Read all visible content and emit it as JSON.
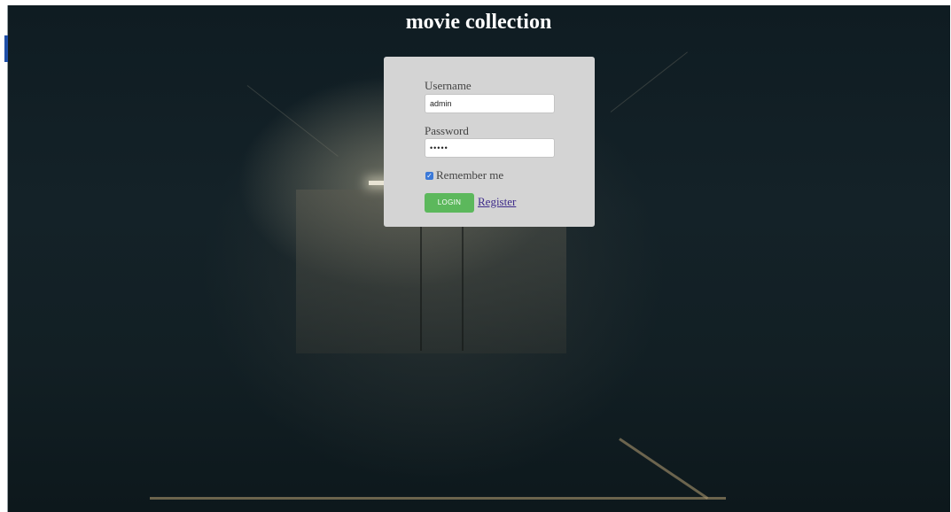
{
  "page": {
    "title": "movie collection"
  },
  "login_form": {
    "username_label": "Username",
    "username_value": "admin",
    "password_label": "Password",
    "password_value": "•••••",
    "remember_label": "Remember me",
    "remember_checked": true,
    "login_button": "LOGIN",
    "register_link": "Register"
  },
  "colors": {
    "background": "#132127",
    "card": "#d4d4d4",
    "login_button": "#5cb85c",
    "checkbox": "#3b79d8",
    "link": "#3d2a8a"
  }
}
